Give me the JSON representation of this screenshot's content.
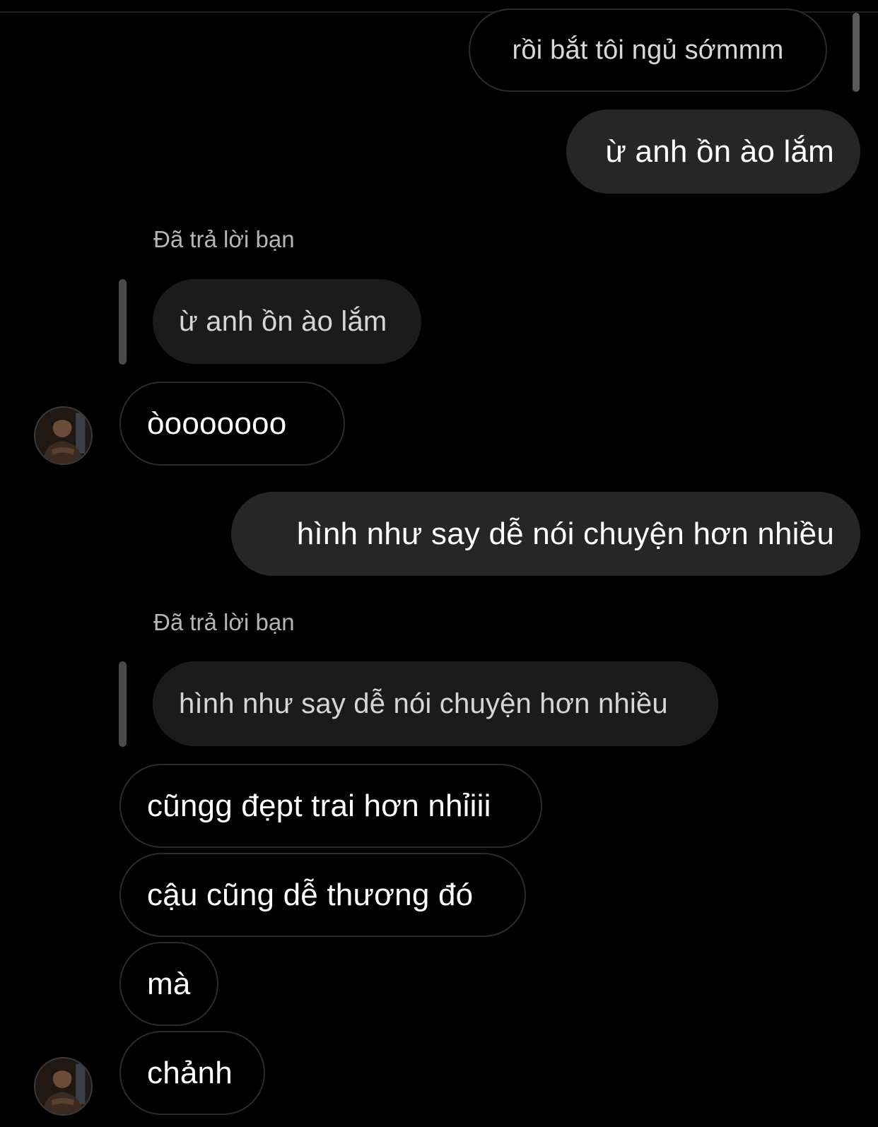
{
  "messages": {
    "m1": "rồi bắt tôi ngủ sớmmm",
    "m2": "ừ anh ồn ào lắm",
    "reply1_label": "Đã trả lời bạn",
    "reply1_quote": "ừ anh ồn ào lắm",
    "m3": "òooooooo",
    "m4": "hình như say dễ nói chuyện hơn nhiều",
    "reply2_label": "Đã trả lời bạn",
    "reply2_quote": "hình như say dễ nói chuyện hơn nhiều",
    "m5": "cũngg đẹpt trai hơn nhỉiii",
    "m6": "cậu cũng dễ thương đó",
    "m7": "mà",
    "m8": "chảnh"
  },
  "colors": {
    "background": "#000000",
    "sent_bubble": "#262626",
    "quote_bubble": "#1b1b1b",
    "outline": "#2b2b2b",
    "reply_label": "#b5b5b5"
  },
  "icons": {
    "avatar": "contact-avatar-photo"
  }
}
